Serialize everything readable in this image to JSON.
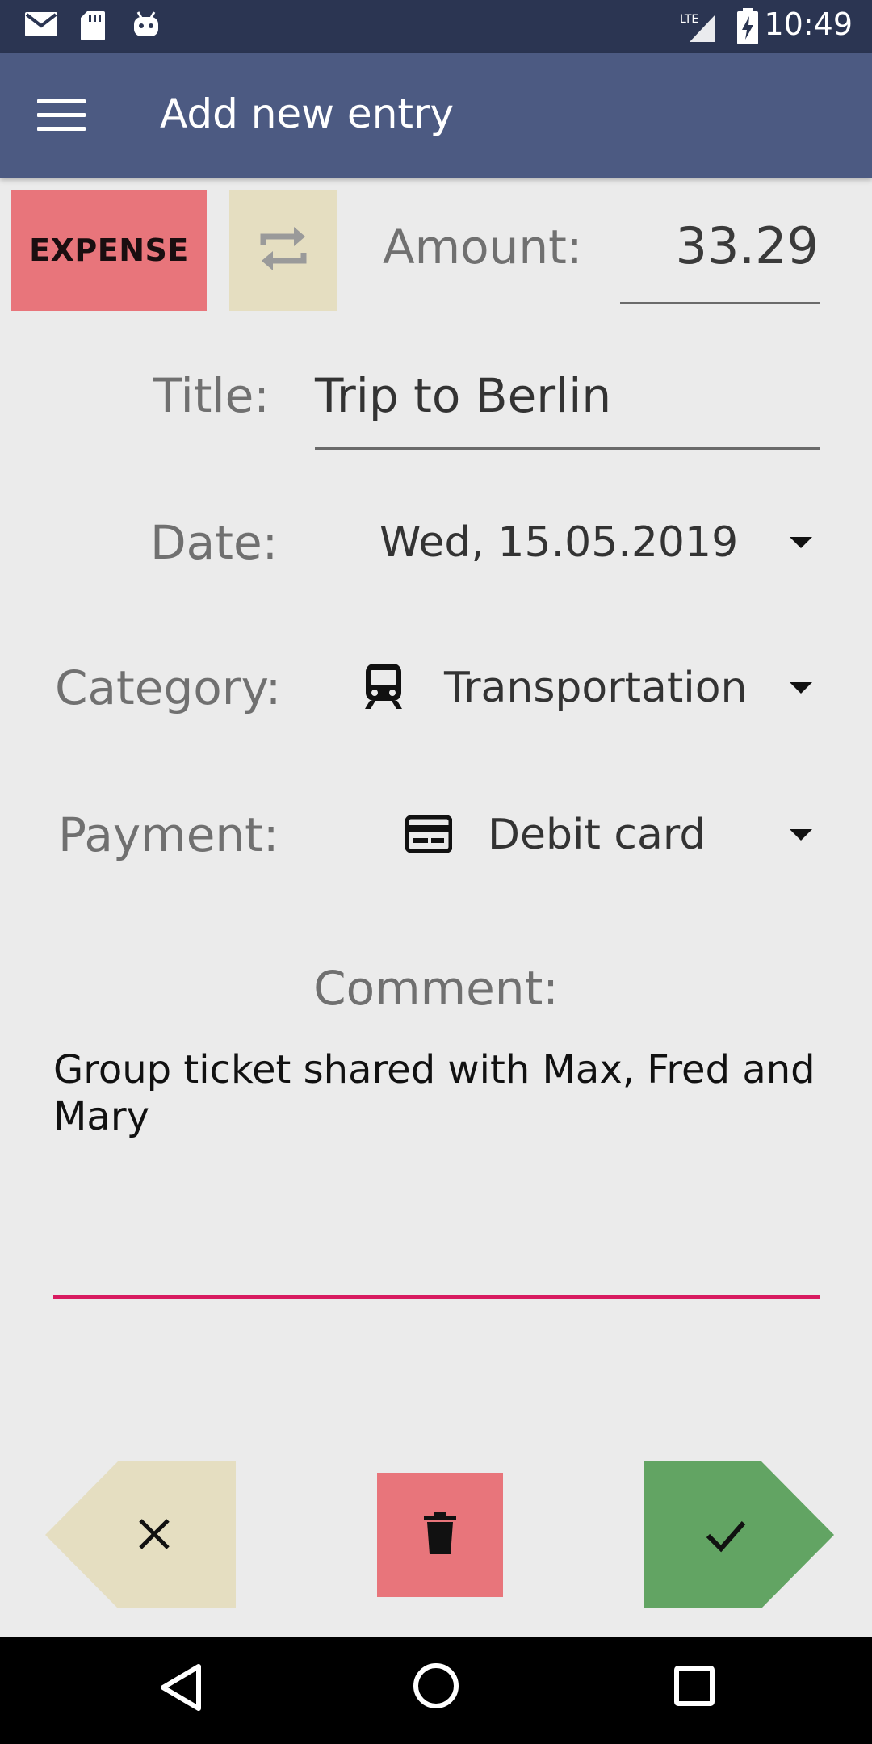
{
  "status_bar": {
    "time": "10:49",
    "network": "LTE",
    "icons": [
      "gmail-icon",
      "sd-card-icon",
      "android-icon",
      "signal-icon",
      "battery-charging-icon"
    ]
  },
  "app_bar": {
    "title": "Add new entry",
    "menu_icon": "hamburger-menu-icon"
  },
  "form": {
    "type_button": "EXPENSE",
    "swap_icon": "swap-icon",
    "amount_label": "Amount:",
    "amount_value": "33.29",
    "title_label": "Title:",
    "title_value": "Trip to Berlin",
    "date_label": "Date:",
    "date_value": "Wed, 15.05.2019",
    "category_label": "Category:",
    "category_value": "Transportation",
    "category_icon": "train-icon",
    "payment_label": "Payment:",
    "payment_value": "Debit card",
    "payment_icon": "credit-card-icon",
    "comment_label": "Comment:",
    "comment_value": "Group ticket shared with Max, Fred and Mary"
  },
  "actions": {
    "cancel_icon": "close-icon",
    "delete_icon": "trash-icon",
    "confirm_icon": "check-icon"
  },
  "colors": {
    "status_bar": "#2b3552",
    "app_bar": "#4c5a82",
    "expense": "#e8757b",
    "neutral_button": "#e5dec1",
    "confirm": "#62a463",
    "accent_underline": "#d81b60",
    "background": "#ebebeb"
  }
}
